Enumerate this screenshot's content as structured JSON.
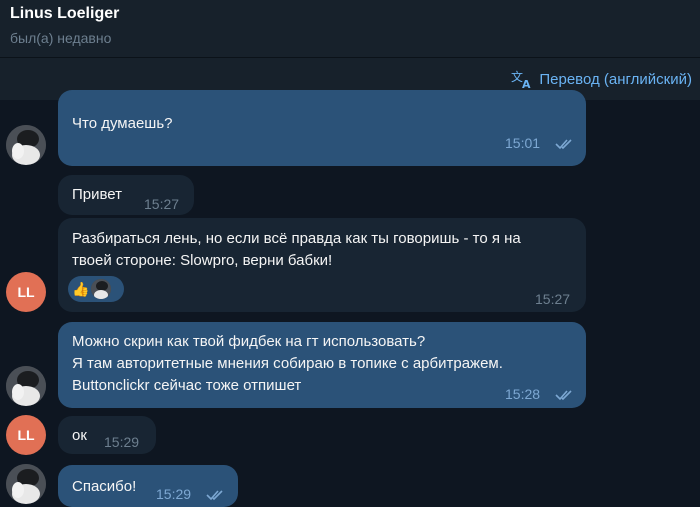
{
  "header": {
    "name": "Linus Loeliger",
    "status": "был(а) недавно"
  },
  "translate": {
    "label": "Перевод (английский)"
  },
  "avatar": {
    "initials": "LL"
  },
  "messages": [
    {
      "direction": "out",
      "text": "Что думаешь?",
      "time": "15:01",
      "read": true
    },
    {
      "direction": "in",
      "text": "Привет",
      "time": "15:27"
    },
    {
      "direction": "in",
      "text_lines": [
        "Разбираться лень, но если всё правда как ты говоришь - то я на",
        "твоей стороне: Slowpro, верни бабки!"
      ],
      "time": "15:27",
      "reaction": "👍"
    },
    {
      "direction": "out",
      "text_lines": [
        "Можно скрин как твой фидбек на гт использовать?",
        "Я там авторитетные мнения собираю в топике с арбитражем.",
        "Buttonclickr сейчас тоже отпишет"
      ],
      "time": "15:28",
      "read": true
    },
    {
      "direction": "in",
      "text": "ок",
      "time": "15:29"
    },
    {
      "direction": "out",
      "text": "Спасибо!",
      "time": "15:29",
      "read": true
    }
  ]
}
